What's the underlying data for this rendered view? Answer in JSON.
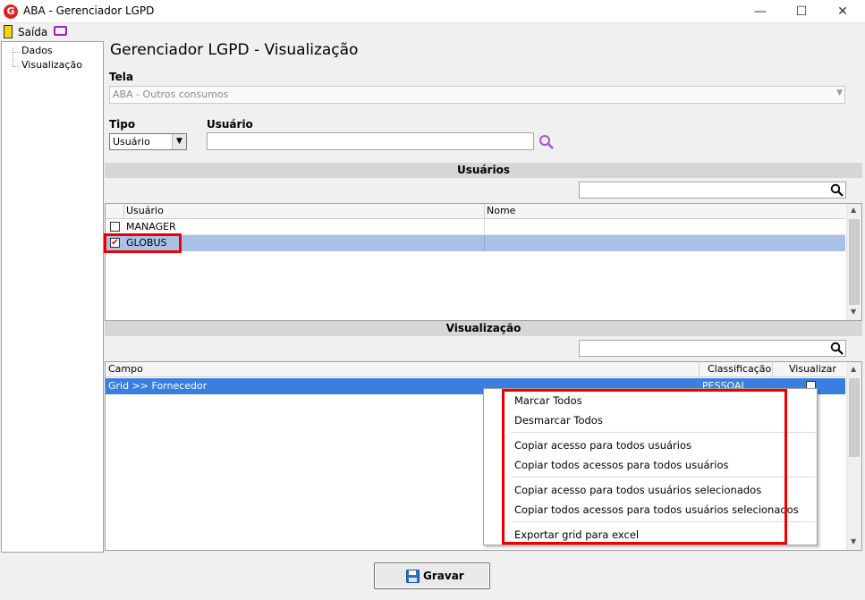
{
  "window": {
    "title": "ABA - Gerenciador LGPD",
    "minimize": "—",
    "maximize": "☐",
    "close": "✕"
  },
  "menubar": {
    "exit_label": "Saída"
  },
  "tree": {
    "items": [
      "Dados",
      "Visualização"
    ]
  },
  "page": {
    "title": "Gerenciador LGPD - Visualização"
  },
  "tela": {
    "label": "Tela",
    "value": "ABA - Outros consumos"
  },
  "tipo": {
    "label": "Tipo",
    "value": "Usuário"
  },
  "usuario": {
    "label": "Usuário",
    "value": ""
  },
  "users_section": {
    "title": "Usuários",
    "columns": [
      "Usuário",
      "Nome"
    ],
    "rows": [
      {
        "usuario": "MANAGER",
        "nome": "",
        "checked": false
      },
      {
        "usuario": "GLOBUS",
        "nome": "",
        "checked": true
      }
    ]
  },
  "vis_section": {
    "title": "Visualização",
    "columns": [
      "Campo",
      "Classificação",
      "Visualizar"
    ],
    "rows": [
      {
        "campo": "Grid >> Fornecedor",
        "classificacao": "PESSOAL",
        "visualizar": false
      }
    ]
  },
  "context_menu": {
    "items": [
      "Marcar Todos",
      "Desmarcar Todos",
      "Copiar acesso para todos usuários",
      "Copiar todos acessos para todos usuários",
      "Copiar acesso para todos usuários selecionados",
      "Copiar todos acessos para todos usuários selecionados",
      "Exportar grid para excel"
    ]
  },
  "footer": {
    "save_label": "Gravar"
  },
  "colors": {
    "selection_light": "#a9c1e8",
    "selection": "#3a7fe0",
    "highlight_red": "#e00000",
    "accent_purple": "#b04fd6"
  }
}
